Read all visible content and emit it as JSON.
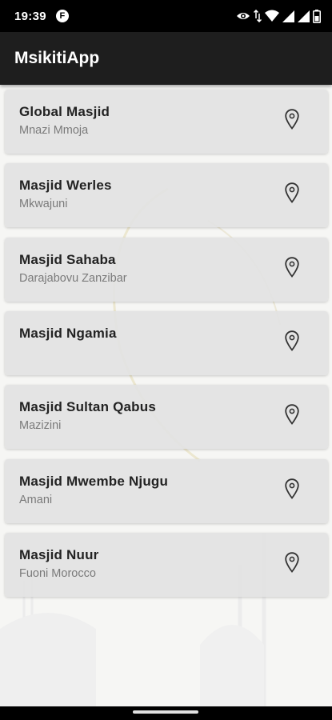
{
  "status_bar": {
    "time": "19:39",
    "app_badge": "F",
    "icons": [
      "eye-icon",
      "data-arrows-icon",
      "wifi-icon",
      "signal-icon",
      "signal-icon",
      "battery-icon"
    ]
  },
  "app_bar": {
    "title": "MsikitiApp"
  },
  "mosques": [
    {
      "name": "Global Masjid",
      "location": "Mnazi Mmoja",
      "icon": "location-pin-icon"
    },
    {
      "name": "Masjid Werles",
      "location": "Mkwajuni",
      "icon": "location-pin-icon"
    },
    {
      "name": "Masjid Sahaba",
      "location": "Darajabovu Zanzibar",
      "icon": "location-pin-icon"
    },
    {
      "name": "Masjid Ngamia",
      "location": "",
      "icon": "location-pin-icon"
    },
    {
      "name": "Masjid Sultan Qabus",
      "location": "Mazizini",
      "icon": "location-pin-icon"
    },
    {
      "name": "Masjid Mwembe Njugu",
      "location": "Amani",
      "icon": "location-pin-icon"
    },
    {
      "name": "Masjid Nuur",
      "location": "Fuoni Morocco",
      "icon": "location-pin-icon"
    }
  ],
  "colors": {
    "status_bar": "#000000",
    "app_bar": "#1e1e1e",
    "card_background": "#e2e2e2",
    "title_text": "#222222",
    "subtitle_text": "#7a7a7a"
  }
}
